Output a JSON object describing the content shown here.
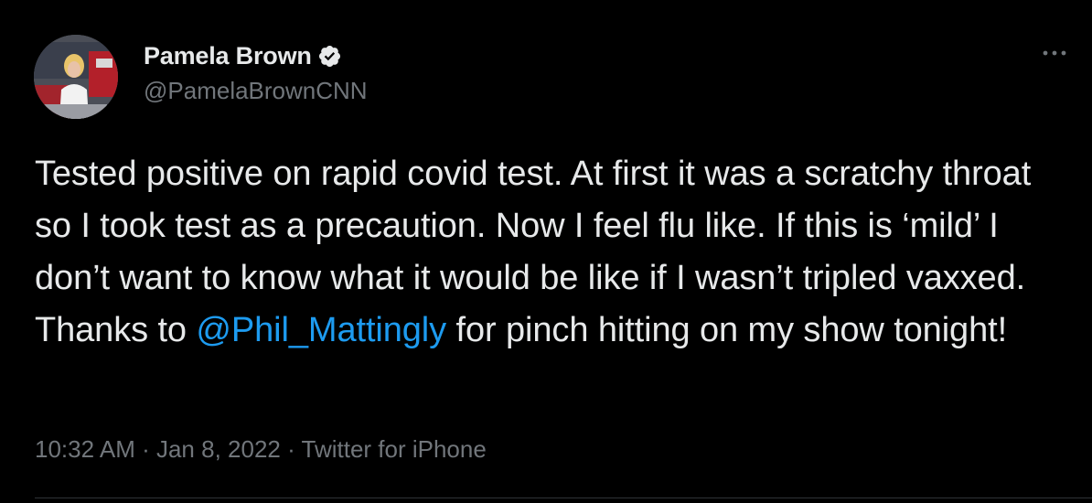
{
  "tweet": {
    "author": {
      "display_name": "Pamela Brown",
      "handle": "@PamelaBrownCNN",
      "verified": true
    },
    "text_before_mention": "Tested positive on rapid covid test. At first it was a scratchy throat so I took test as a precaution. Now I feel flu like. If this is ‘mild’ I don’t want to know what it would be like if I wasn’t tripled vaxxed. Thanks to ",
    "mention": "@Phil_Mattingly",
    "text_after_mention": " for pinch hitting on my show tonight!",
    "time": "10:32 AM",
    "separator": " · ",
    "date": "Jan 8, 2022",
    "source": "Twitter for iPhone"
  },
  "colors": {
    "background": "#000000",
    "primary_text": "#e7e9ea",
    "secondary_text": "#71767b",
    "link": "#1d9bf0",
    "verified_badge": "#e7e9ea"
  },
  "icons": {
    "verified": "verified-badge-icon",
    "more": "more-horizontal-icon"
  }
}
